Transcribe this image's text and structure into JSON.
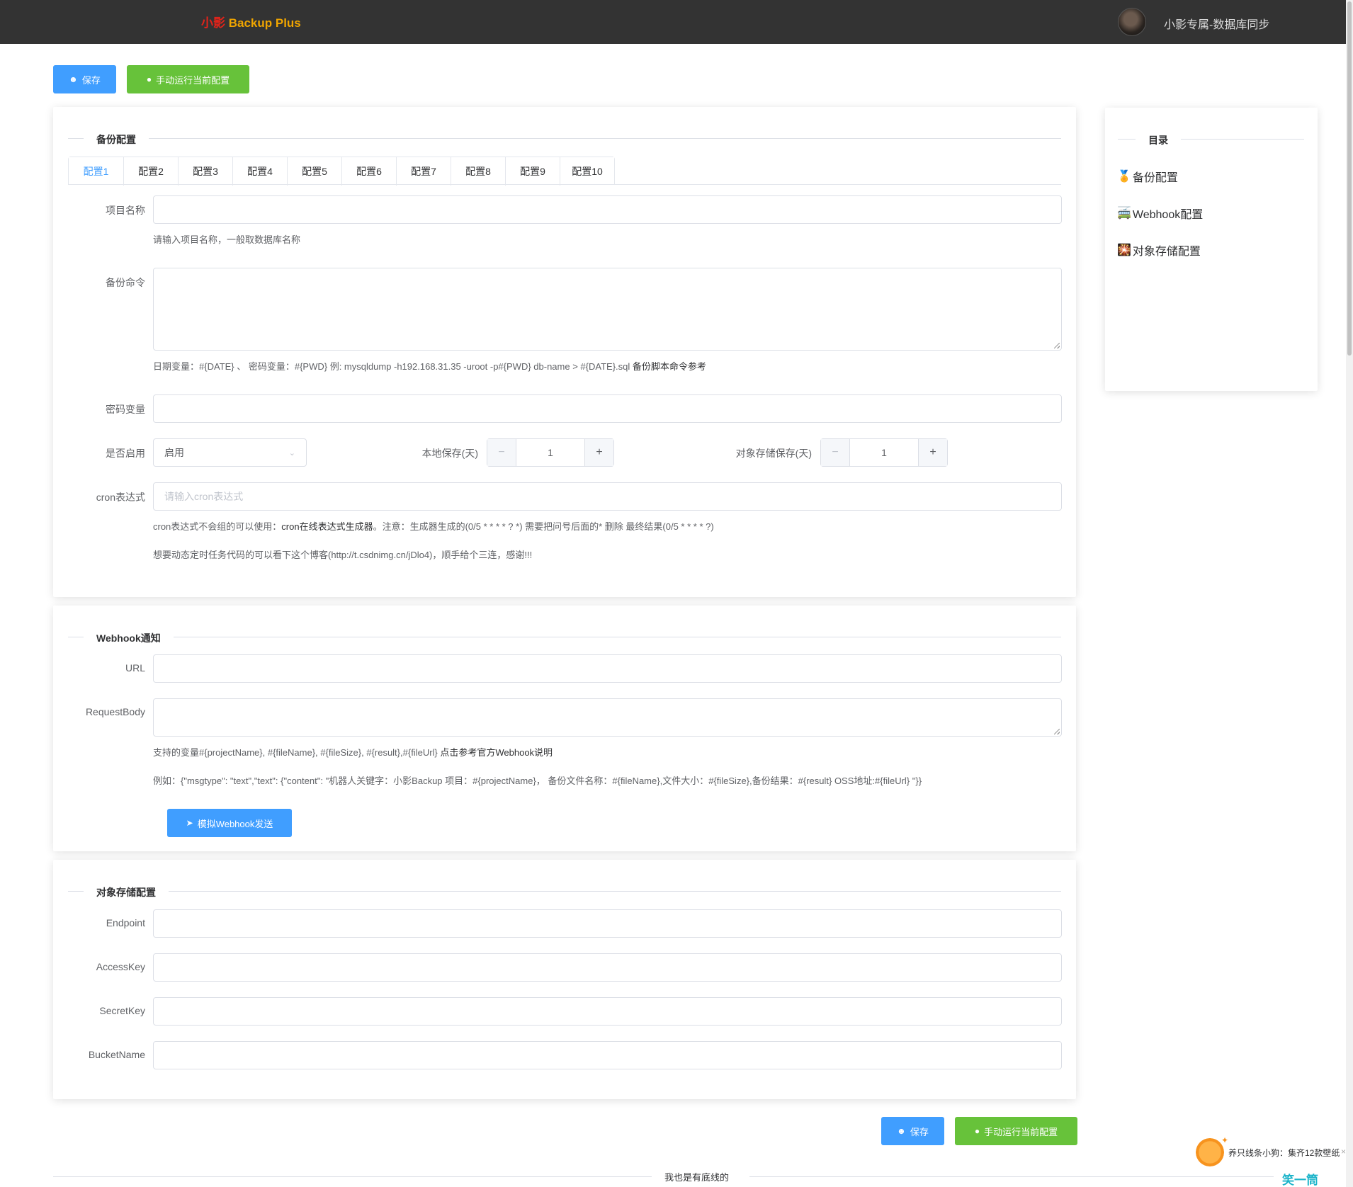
{
  "header": {
    "logo_part1": "小影",
    "logo_part2": " Backup Plus",
    "user_name": "小影专属-数据库同步"
  },
  "toolbar": {
    "save_label": "保存",
    "run_label": "手动运行当前配置"
  },
  "backup": {
    "section_title": "备份配置",
    "tabs": [
      "配置1",
      "配置2",
      "配置3",
      "配置4",
      "配置5",
      "配置6",
      "配置7",
      "配置8",
      "配置9",
      "配置10"
    ],
    "project_name_label": "项目名称",
    "project_name_value": "",
    "project_name_help": "请输入项目名称，一般取数据库名称",
    "command_label": "备份命令",
    "command_help_prefix": "日期变量：#{DATE} 、 密码变量：#{PWD} 例: mysqldump -h192.168.31.35 -uroot -p#{PWD} db-name > #{DATE}.sql ",
    "command_help_link": "备份脚本命令参考",
    "password_var_label": "密码变量",
    "enabled_label": "是否启用",
    "enabled_value": "启用",
    "local_keep_label": "本地保存(天)",
    "local_keep_value": "1",
    "oss_keep_label": "对象存储保存(天)",
    "oss_keep_value": "1",
    "cron_label": "cron表达式",
    "cron_placeholder": "请输入cron表达式",
    "cron_help_prefix": "cron表达式不会组的可以使用：",
    "cron_help_link": "cron在线表达式生成器",
    "cron_help_suffix": "。注意：生成器生成的(0/5 * * * * ? *) 需要把问号后面的* 删除 最终结果(0/5 * * * * ?)",
    "dynamic_help": "想要动态定时任务代码的可以看下这个博客(http://t.csdnimg.cn/jDlo4)，顺手给个三连，感谢!!!"
  },
  "webhook": {
    "section_title": "Webhook通知",
    "url_label": "URL",
    "body_label": "RequestBody",
    "help_prefix": "支持的变量#{projectName}, #{fileName}, #{fileSize}, #{result},#{fileUrl} ",
    "help_link": "点击参考官方Webhook说明",
    "example": "例如：{\"msgtype\": \"text\",\"text\": {\"content\": \"机器人关键字：小影Backup 项目：#{projectName}， 备份文件名称：#{fileName},文件大小：#{fileSize},备份结果：#{result} OSS地址:#{fileUrl} \"}}",
    "simulate_label": "模拟Webhook发送"
  },
  "oss": {
    "section_title": "对象存储配置",
    "endpoint_label": "Endpoint",
    "accesskey_label": "AccessKey",
    "secretkey_label": "SecretKey",
    "bucket_label": "BucketName"
  },
  "toc": {
    "title": "目录",
    "items": [
      {
        "emoji": "🏅",
        "label": "备份配置"
      },
      {
        "emoji": "🚎",
        "label": "Webhook配置"
      },
      {
        "emoji": "🎇",
        "label": "对象存储配置"
      }
    ]
  },
  "footer": {
    "text": "我也是有底线的"
  },
  "widget": {
    "text": "养只线条小狗：集齐12款壁纸",
    "deco": "笑一筒"
  },
  "colors": {
    "primary": "#409eff",
    "success": "#67c23a",
    "header_bg": "#333333"
  }
}
